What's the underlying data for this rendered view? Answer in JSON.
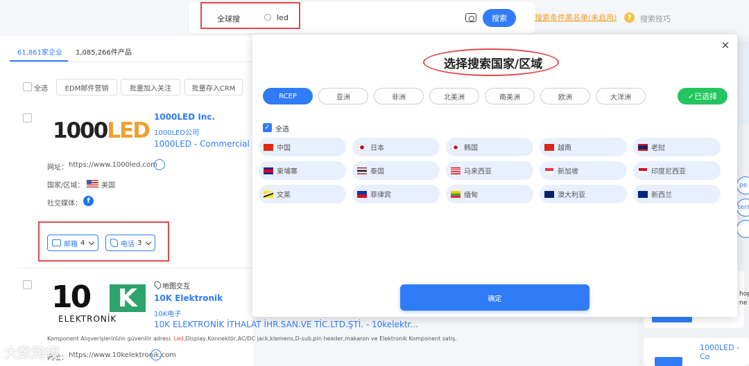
{
  "search": {
    "scope_label": "全球搜",
    "query": "led",
    "search_button": "搜索",
    "blacklist_link": "搜索条件黑名单(未启用)",
    "tips_text": "搜索技巧",
    "tips_glyph": "?"
  },
  "results": {
    "tab_companies": "61,861家企业",
    "tab_products": "1,085,266件产品",
    "select_all": "全选",
    "actions": [
      "EDM邮件营销",
      "批量加入关注",
      "批量存入CRM"
    ],
    "cards": [
      {
        "logo_text_a": "1000",
        "logo_text_b": "LED",
        "name": "1000LED Inc.",
        "name_cn": "1000LED公司",
        "desc": "1000LED - Commercial LE",
        "website_label": "网址：",
        "website": "https://www.1000led.com",
        "country_label": "国家/区域：",
        "country": "美国",
        "social_label": "社交媒体：",
        "email_label": "邮箱",
        "email_count": "4",
        "phone_label": "电话",
        "phone_count": "3"
      },
      {
        "logo_num": "10",
        "logo_k": "K",
        "logo_sub": "ELEKTRONİK",
        "map_label": "地图交互",
        "name": "10K Elektronik",
        "name_cn": "10K电子",
        "desc": "10K ELEKTRONİK İTHALAT İHR.SAN.VE TİC.LTD.ŞTİ. - 10kelektr...",
        "small_desc_a": "Komponent Alışverişlerinizin güvenilir adresi. ",
        "small_desc_hl": "Led",
        "small_desc_b": ",Display,Konnektör,AC/DC jack,klemens,D-sub,pin header,makaron ve Elektronik Komponent satış.",
        "website_label": "网址：",
        "website": "https://www.10kelektronik.com"
      }
    ]
  },
  "watermark": "大数跨境",
  "right_panel": {
    "card_name": "1000LED - Co",
    "text_fragments": [
      "pe",
      "ters",
      "hop",
      "ne"
    ]
  },
  "modal": {
    "title": "选择搜索国家/区域",
    "close_glyph": "×",
    "regions": [
      "RCEP",
      "亚洲",
      "非洲",
      "北美洲",
      "南美洲",
      "欧洲",
      "大洋洲"
    ],
    "selected_button": "✓已选择",
    "select_all": "全选",
    "check_glyph": "✓",
    "countries": [
      "中国",
      "日本",
      "韩国",
      "越南",
      "老挝",
      "柬埔寨",
      "泰国",
      "马来西亚",
      "新加坡",
      "印度尼西亚",
      "文莱",
      "菲律宾",
      "缅甸",
      "澳大利亚",
      "新西兰"
    ],
    "confirm_button": "确定"
  },
  "colors": {
    "accent": "#2f7cf6",
    "highlight_box": "#e04848",
    "selected_green": "#22c55e",
    "link_orange": "#f0a020"
  }
}
